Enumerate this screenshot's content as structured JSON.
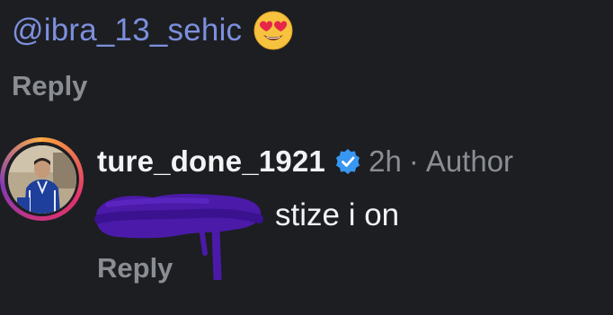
{
  "mention": {
    "text": "@ibra_13_sehic",
    "emoji": "heart-eyes-emoji"
  },
  "reply_top": {
    "label": "Reply"
  },
  "comment": {
    "username": "ture_done_1921",
    "verified_icon": "verified-badge-icon",
    "time": "2h",
    "separator": "·",
    "role": "Author",
    "text": "stize i on",
    "reply_label": "Reply"
  },
  "colors": {
    "background": "#1c1e22",
    "mention": "#7d8fdc",
    "muted": "#8a8d92",
    "verified": "#3897f0",
    "redaction": "#4b1aa8"
  }
}
